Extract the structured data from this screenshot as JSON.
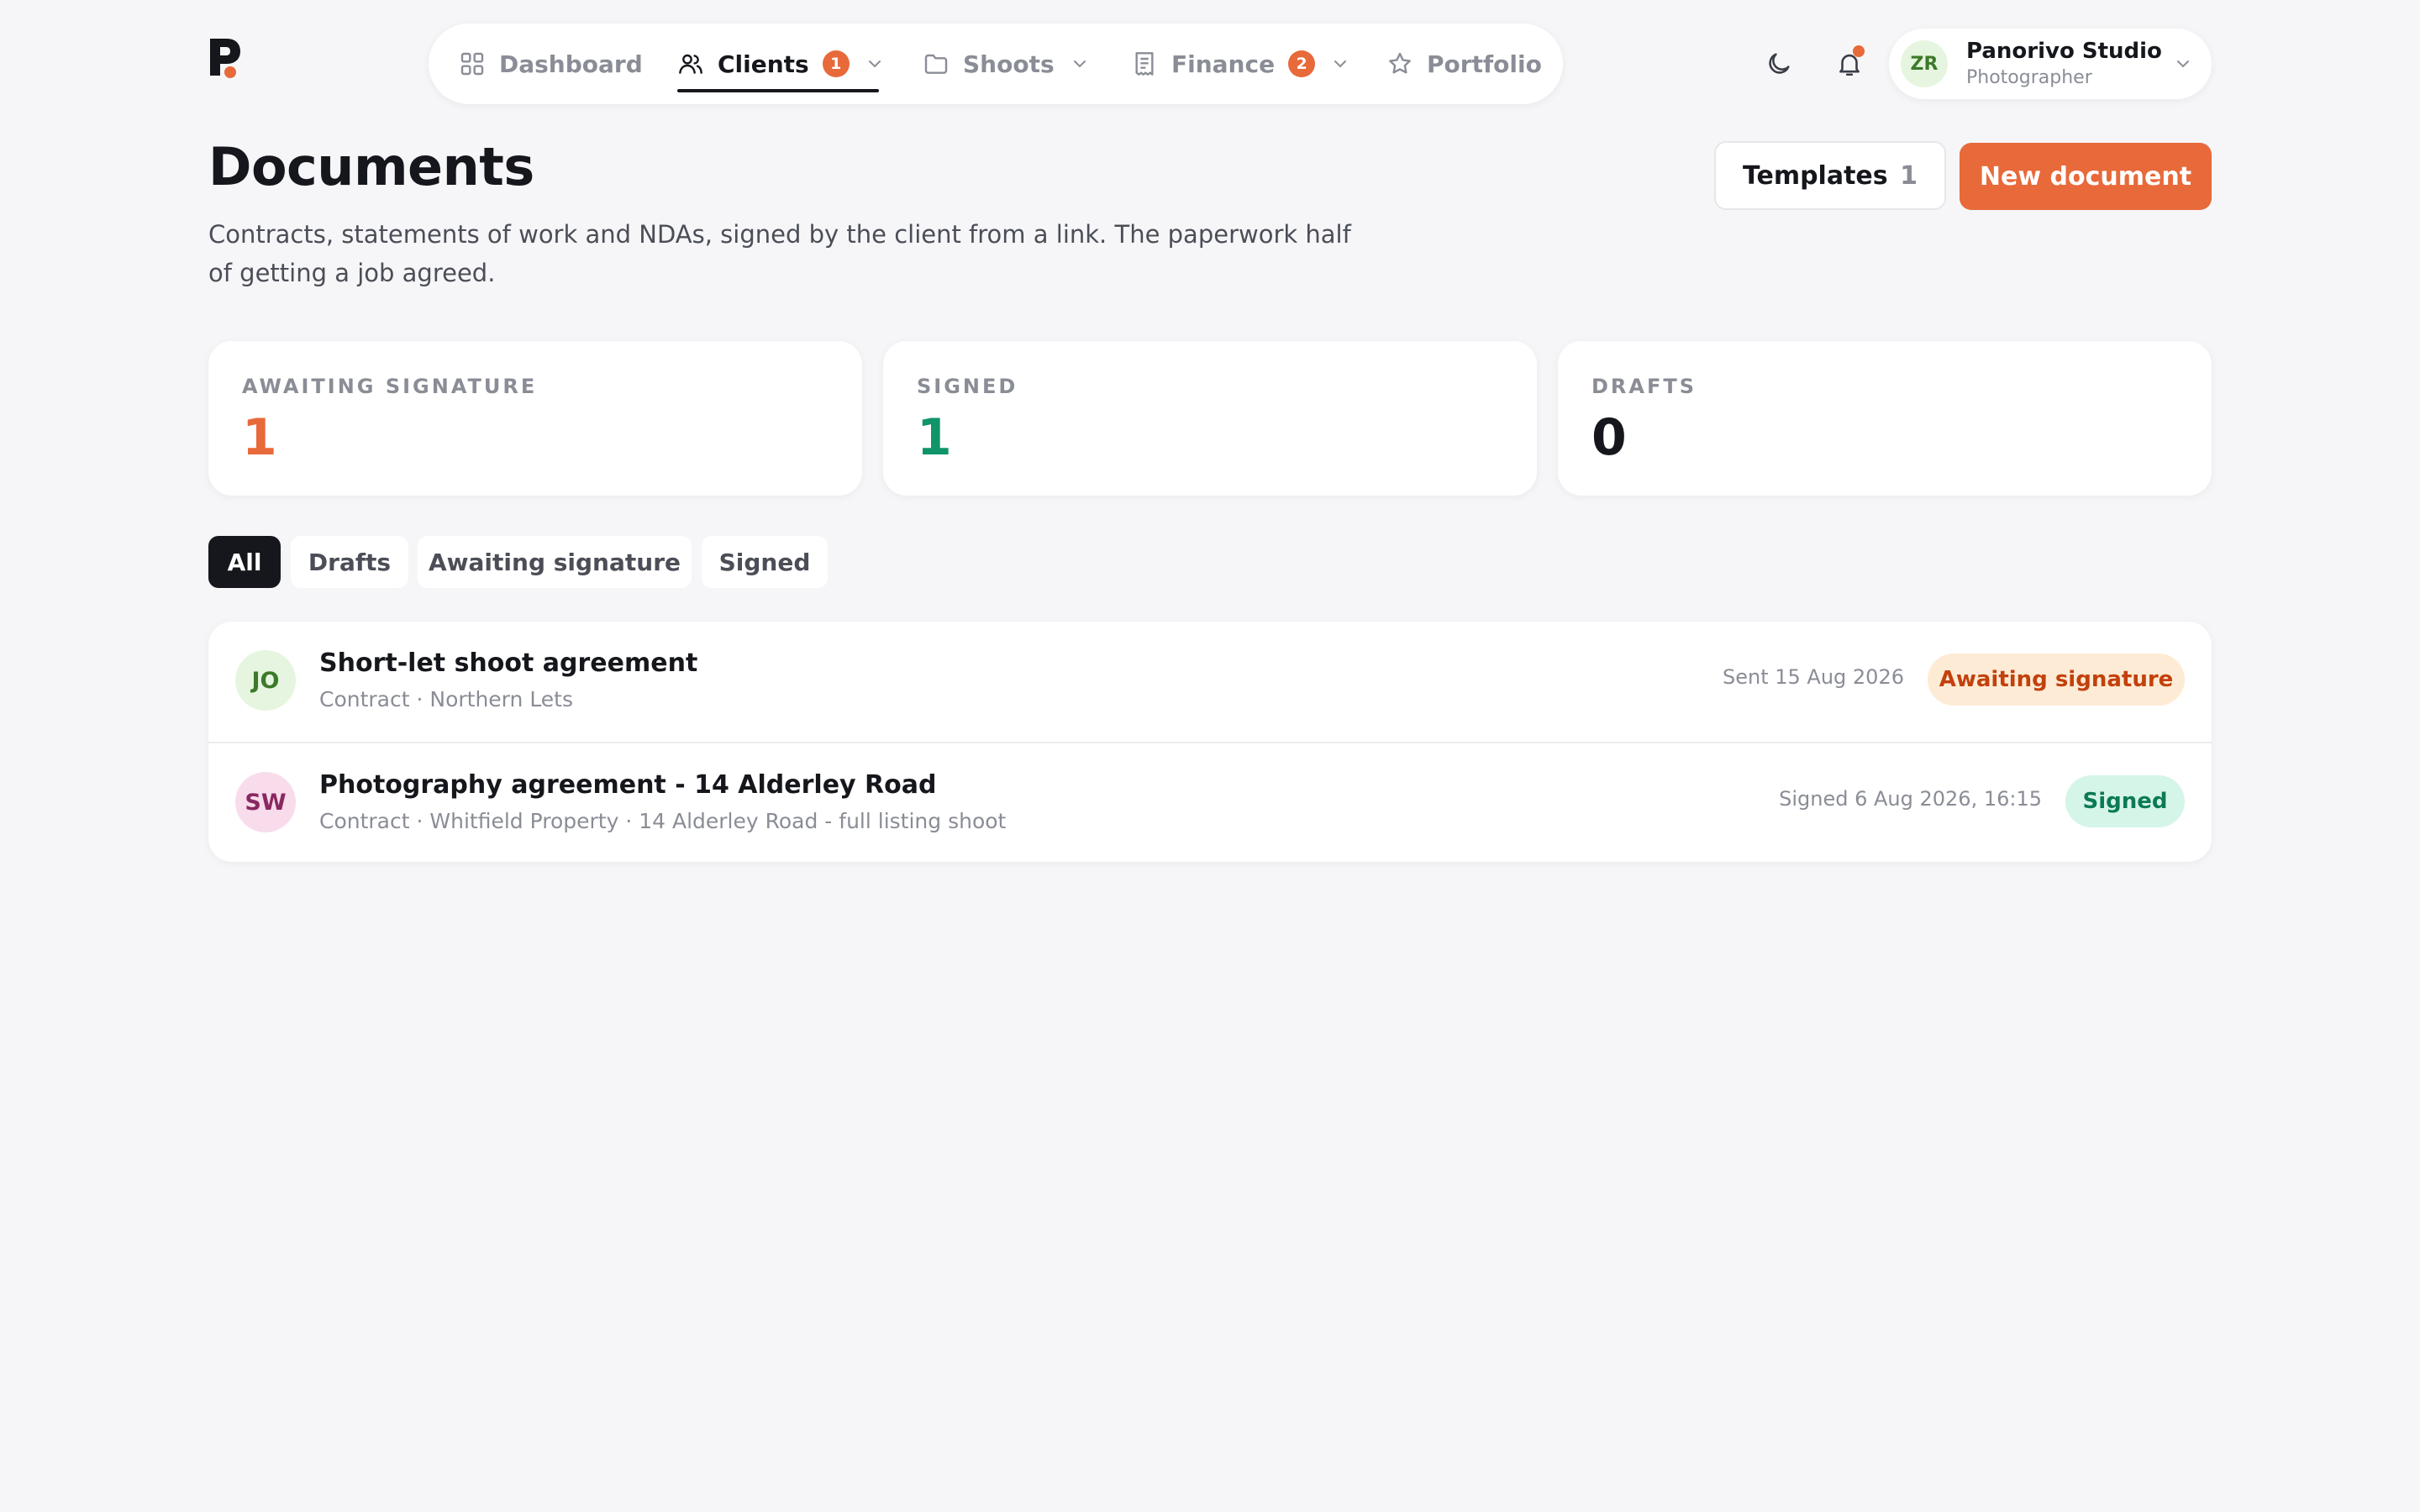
{
  "nav": {
    "items": [
      {
        "label": "Dashboard"
      },
      {
        "label": "Clients",
        "badge": "1"
      },
      {
        "label": "Shoots"
      },
      {
        "label": "Finance",
        "badge": "2"
      },
      {
        "label": "Portfolio"
      }
    ],
    "active": "Clients"
  },
  "user": {
    "initials": "ZR",
    "name": "Panorivo Studio",
    "role": "Photographer"
  },
  "header": {
    "title": "Documents",
    "description": "Contracts, statements of work and NDAs, signed by the client from a link. The paperwork half of getting a job agreed.",
    "templates_label": "Templates",
    "templates_count": "1",
    "new_document_label": "New document"
  },
  "stats": [
    {
      "label": "AWAITING SIGNATURE",
      "value": "1",
      "color": "#e8693a"
    },
    {
      "label": "SIGNED",
      "value": "1",
      "color": "#11946a"
    },
    {
      "label": "DRAFTS",
      "value": "0",
      "color": "#15171c"
    }
  ],
  "filters": {
    "items": [
      "All",
      "Drafts",
      "Awaiting signature",
      "Signed"
    ],
    "active": "All"
  },
  "documents": [
    {
      "initials": "JO",
      "title": "Short-let shoot agreement",
      "subtitle": "Contract · Northern Lets",
      "date": "Sent 15 Aug 2026",
      "status": "Awaiting signature",
      "status_color": "#c2410c",
      "status_bg": "#fdebd5"
    },
    {
      "initials": "SW",
      "title": "Photography agreement - 14 Alderley Road",
      "subtitle": "Contract · Whitfield Property · 14 Alderley Road - full listing shoot",
      "date": "Signed 6 Aug 2026, 16:15",
      "status": "Signed",
      "status_color": "#0b7a55",
      "status_bg": "#d5f5e8"
    }
  ],
  "icons": {
    "logo": "brand-p-logo",
    "theme": "moon-icon",
    "notifications": "bell-icon"
  }
}
